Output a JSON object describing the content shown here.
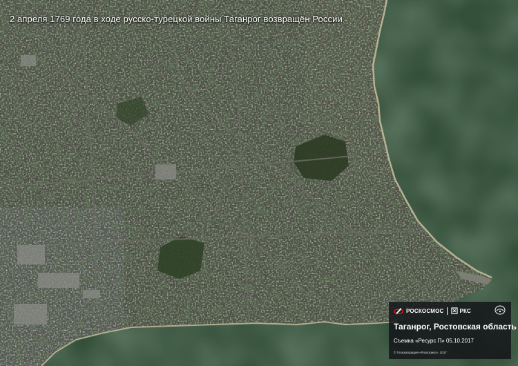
{
  "headline": "2 апреля 1769 года в ходе русско-турецкой войны Таганрог возвращён России",
  "info_panel": {
    "brand_left": "РОСКОСМОС",
    "brand_right": "РКС",
    "place_name": "Таганрог, Ростовская область",
    "survey_text": "Съемка «Ресурс П» 05.10.2017",
    "copyright_text": "© Госкорпорация «Роскосмос», 2017",
    "icons": [
      "rocket-icon",
      "rks-icon",
      "emblem-icon"
    ]
  },
  "colors": {
    "sea": "#35503a",
    "land": "#4c5343",
    "shore": "#c9bfa0",
    "panel": "#121418"
  }
}
